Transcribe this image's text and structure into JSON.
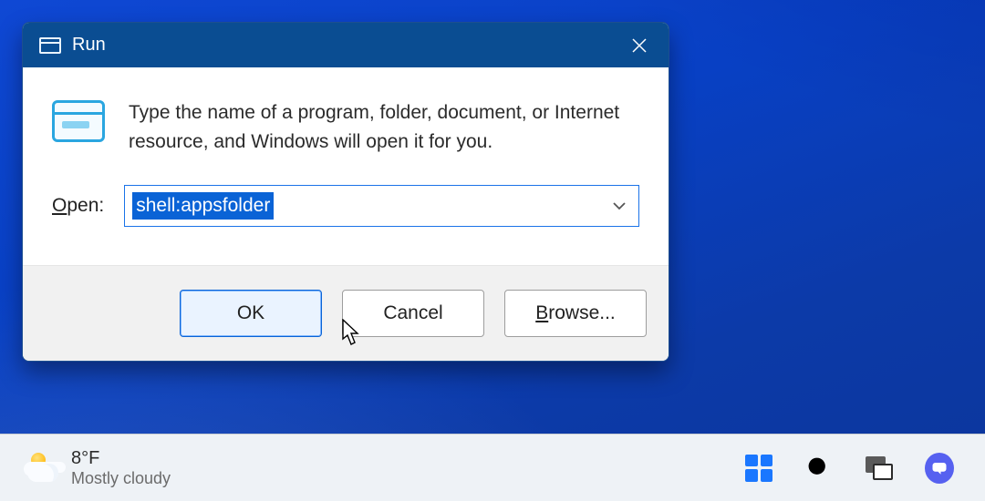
{
  "dialog": {
    "title": "Run",
    "description": "Type the name of a program, folder, document, or Internet resource, and Windows will open it for you.",
    "open_label_pre": "O",
    "open_label_post": "pen:",
    "input_value": "shell:appsfolder",
    "ok_label": "OK",
    "cancel_label": "Cancel",
    "browse_label_pre": "B",
    "browse_label_post": "rowse..."
  },
  "taskbar": {
    "temperature": "8°F",
    "condition": "Mostly cloudy"
  }
}
